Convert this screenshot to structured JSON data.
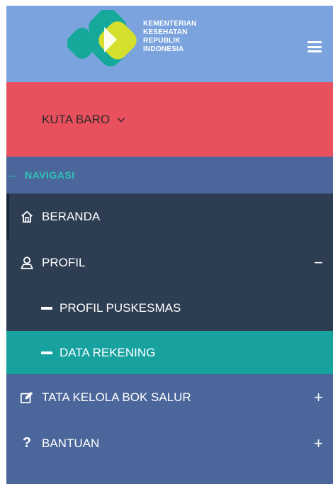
{
  "logo": {
    "lines": [
      "KEMENTERIAN",
      "KESEHATAN",
      "REPUBLIK",
      "INDONESIA"
    ]
  },
  "header": {
    "menu_icon": "hamburger-icon"
  },
  "location": {
    "selected": "KUTA BARO",
    "icon": "chevron-down-icon"
  },
  "nav": {
    "heading_dash": "---",
    "heading": "NAVIGASI",
    "items": [
      {
        "label": "BERANDA",
        "icon": "home-icon"
      },
      {
        "label": "PROFIL",
        "icon": "user-icon",
        "toggle": "−"
      },
      {
        "label": "PROFIL PUSKESMAS"
      },
      {
        "label": "DATA REKENING",
        "active": true
      },
      {
        "label": "TATA KELOLA BOK SALUR",
        "icon": "edit-icon",
        "toggle": "+"
      },
      {
        "label": "BANTUAN",
        "icon": "question-icon",
        "glyph": "?",
        "toggle": "+"
      }
    ]
  },
  "colors": {
    "header": "#7ba3dd",
    "location": "#e8505e",
    "sidebar": "#4a669a",
    "submenu": "#2e3e52",
    "active": "#17a2a0",
    "accent": "#2ec4b6"
  }
}
